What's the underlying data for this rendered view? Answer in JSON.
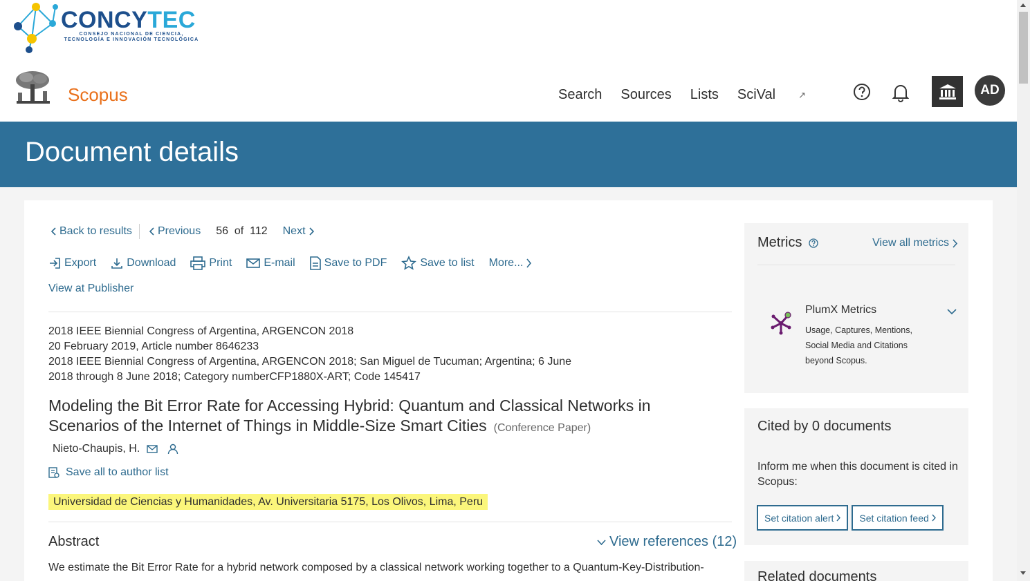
{
  "logo": {
    "name": "CONCY",
    "name2": "TEC",
    "sub_line1": "CONSEJO NACIONAL DE CIENCIA,",
    "sub_line2": "TECNOLOGÍA E INNOVACIÓN TECNOLÓGICA"
  },
  "header": {
    "brand": "Scopus",
    "nav": [
      "Search",
      "Sources",
      "Lists",
      "SciVal"
    ],
    "avatar_initials": "AD"
  },
  "banner": {
    "title": "Document details"
  },
  "pager": {
    "back": "Back to results",
    "previous": "Previous",
    "current": "56",
    "of": "of",
    "total": "112",
    "next": "Next"
  },
  "actions": {
    "export": "Export",
    "download": "Download",
    "print": "Print",
    "email": "E-mail",
    "save_pdf": "Save to PDF",
    "save_list": "Save to list",
    "more": "More...",
    "view_publisher": "View at Publisher"
  },
  "source": {
    "line1": "2018 IEEE Biennial Congress of Argentina, ARGENCON 2018",
    "line2": "20 February 2019, Article number 8646233",
    "line3": "2018 IEEE Biennial Congress of Argentina, ARGENCON 2018; San Miguel de Tucuman; Argentina; 6 June",
    "line4": "2018 through 8 June 2018; Category numberCFP1880X-ART; Code 145417"
  },
  "document": {
    "title": "Modeling the Bit Error Rate for Accessing Hybrid: Quantum and Classical Networks in Scenarios of the Internet of Things in Middle-Size Smart Cities",
    "type": "(Conference Paper)",
    "author": "Nieto-Chaupis, H.",
    "save_author": "Save all to author list",
    "affiliation": "Universidad de Ciencias y Humanidades, Av. Universitaria 5175, Los Olivos, Lima, Peru"
  },
  "abstract": {
    "heading": "Abstract",
    "view_refs": "View references (12)",
    "text": "We estimate the Bit Error Rate for a hybrid network composed by a classical network working together to a Quantum-Key-Distribution-"
  },
  "metrics": {
    "heading": "Metrics",
    "view_all": "View all metrics",
    "plumx_title": "PlumX Metrics",
    "plumx_desc": "Usage, Captures, Mentions, Social Media and Citations beyond Scopus."
  },
  "cited": {
    "heading": "Cited by 0 documents",
    "inform": "Inform me when this document is cited in Scopus:",
    "alert_btn": "Set citation alert",
    "feed_btn": "Set citation feed"
  },
  "related": {
    "heading": "Related documents"
  },
  "colors": {
    "brand_orange": "#e9711c",
    "banner_blue": "#2e7099",
    "link_blue": "#2e6b8f",
    "highlight": "#fbf67b"
  }
}
